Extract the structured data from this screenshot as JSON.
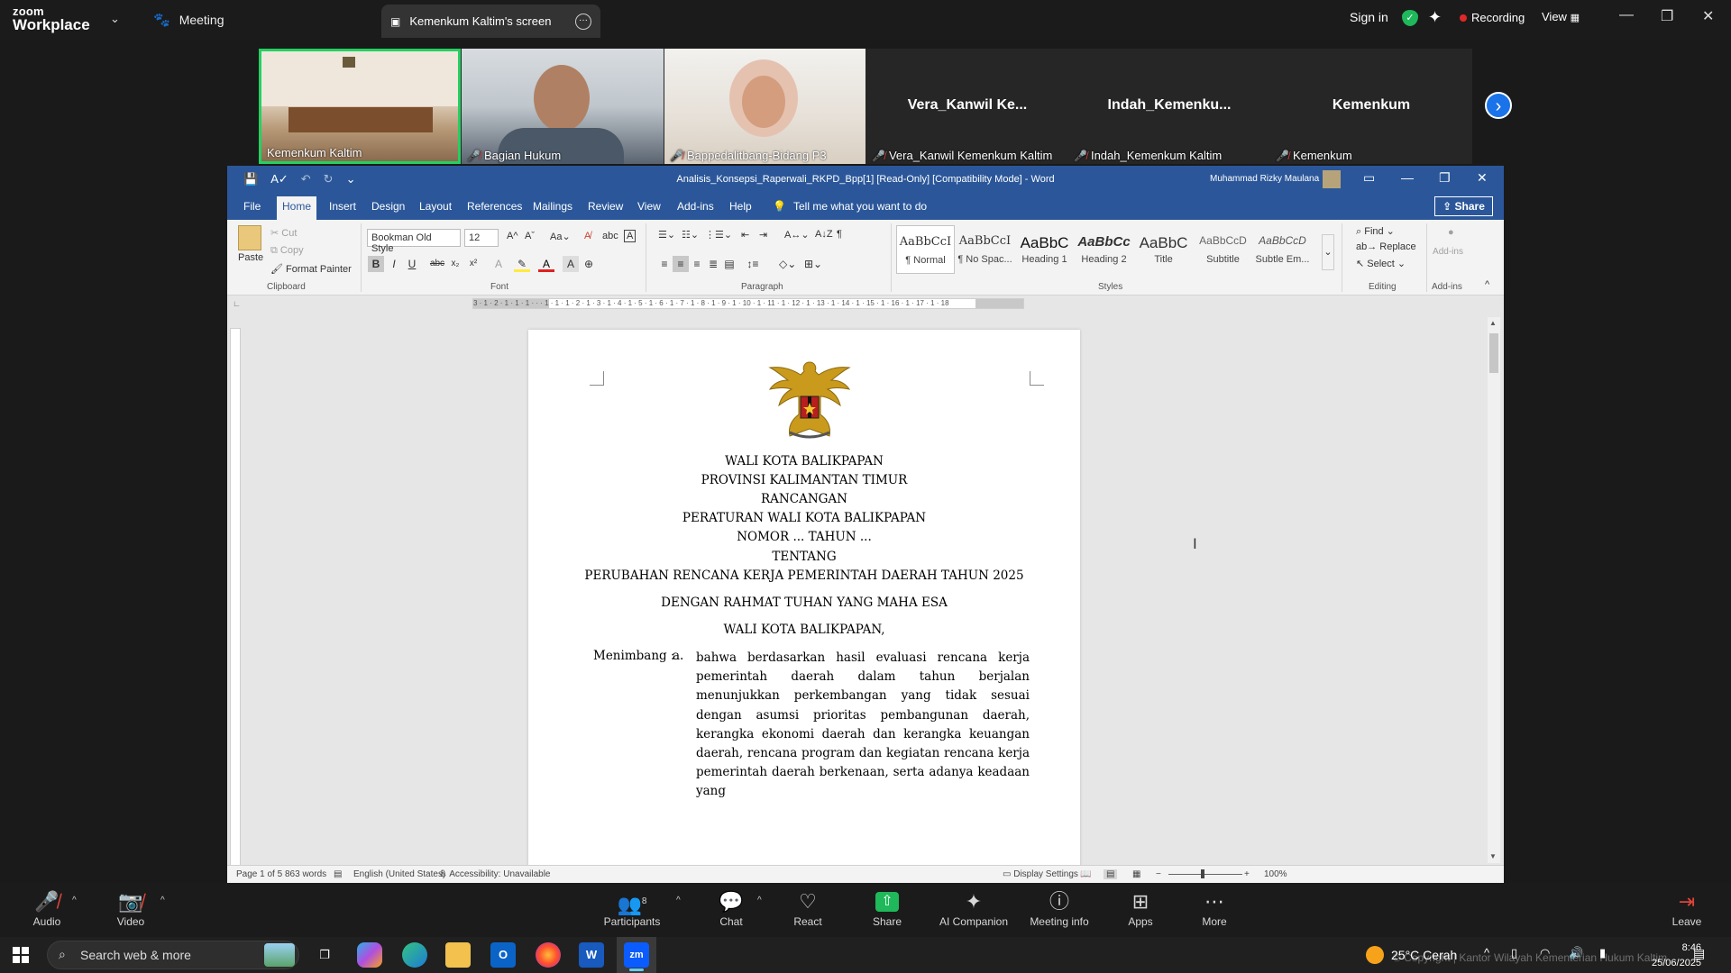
{
  "zoom_top": {
    "logo_line1": "zoom",
    "logo_line2": "Workplace",
    "meeting_label": "Meeting",
    "screen_tab_label": "Kemenkum Kaltim's screen",
    "signin_label": "Sign in",
    "recording_label": "Recording",
    "view_label": "View"
  },
  "participants": [
    {
      "name": "Kemenkum Kaltim",
      "muted": false
    },
    {
      "name": "Bagian Hukum",
      "muted": true
    },
    {
      "name": "Bappedalitbang-Bidang P3",
      "muted": true
    },
    {
      "name": "Vera_Kanwil Kemenkum Kaltim",
      "display": "Vera_Kanwil  Ke...",
      "muted": true
    },
    {
      "name": "Indah_Kemenkum Kaltim",
      "display": "Indah_Kemenku...",
      "muted": true
    },
    {
      "name": "Kemenkum",
      "display": "Kemenkum",
      "muted": true
    }
  ],
  "word": {
    "doc_title": "Analisis_Konsepsi_Raperwali_RKPD_Bpp[1] [Read-Only] [Compatibility Mode]  -  Word",
    "user_name": "Muhammad Rizky Maulana",
    "tabs": [
      "File",
      "Home",
      "Insert",
      "Design",
      "Layout",
      "References",
      "Mailings",
      "Review",
      "View",
      "Add-ins",
      "Help"
    ],
    "tell_me": "Tell me what you want to do",
    "share_label": "Share",
    "clipboard": {
      "paste": "Paste",
      "cut": "Cut",
      "copy": "Copy",
      "format_painter": "Format Painter",
      "group": "Clipboard"
    },
    "font": {
      "name": "Bookman Old Style",
      "size": "12",
      "group": "Font"
    },
    "paragraph_group": "Paragraph",
    "styles": [
      {
        "preview": "AaBbCcI",
        "label": "¶ Normal"
      },
      {
        "preview": "AaBbCcI",
        "label": "¶ No Spac..."
      },
      {
        "preview": "AaBbC",
        "label": "Heading 1"
      },
      {
        "preview": "AaBbCc",
        "label": "Heading 2"
      },
      {
        "preview": "AaBbC",
        "label": "Title"
      },
      {
        "preview": "AaBbCcD",
        "label": "Subtitle"
      },
      {
        "preview": "AaBbCcD",
        "label": "Subtle Em..."
      }
    ],
    "styles_group": "Styles",
    "editing": {
      "find": "Find",
      "replace": "Replace",
      "select": "Select",
      "group": "Editing"
    },
    "addins": {
      "label": "Add-ins",
      "group": "Add-ins"
    },
    "ruler_text": "3 · 1 · 2 · 1 · 1 · 1 · · · 1 · 1 · 1 · 2 · 1 · 3 · 1 · 4 · 1 · 5 · 1 · 6 · 1 · 7 · 1 · 8 · 1 · 9 · 1 · 10 · 1 · 11 · 1 · 12 · 1 · 13 · 1 · 14 · 1 · 15 · 1 · 16 · 1 · 17 · 1 · 18",
    "document": {
      "heading_lines": [
        "WALI KOTA BALIKPAPAN",
        "PROVINSI KALIMANTAN TIMUR",
        "RANCANGAN",
        "PERATURAN WALI KOTA BALIKPAPAN",
        "NOMOR ... TAHUN ...",
        "TENTANG",
        "PERUBAHAN RENCANA KERJA PEMERINTAH DAERAH TAHUN 2025"
      ],
      "rahmat": "DENGAN RAHMAT TUHAN YANG MAHA ESA",
      "wali": "WALI KOTA BALIKPAPAN,",
      "menimbang_label": "Menimbang :",
      "item_letter": "a.",
      "body": "bahwa berdasarkan hasil evaluasi rencana kerja pemerintah daerah dalam tahun berjalan menunjukkan perkembangan yang tidak sesuai dengan asumsi prioritas pembangunan daerah, kerangka ekonomi daerah dan kerangka keuangan daerah, rencana program dan kegiatan rencana kerja pemerintah daerah berkenaan, serta adanya keadaan yang"
    },
    "status": {
      "page": "Page 1 of 5",
      "words": "863 words",
      "language": "English (United States)",
      "accessibility": "Accessibility: Unavailable",
      "display_settings": "Display Settings",
      "zoom": "100%"
    }
  },
  "zoom_bottom": {
    "audio": "Audio",
    "video": "Video",
    "participants": "Participants",
    "participants_count": "8",
    "chat": "Chat",
    "react": "React",
    "share": "Share",
    "ai": "AI Companion",
    "info": "Meeting info",
    "apps": "Apps",
    "more": "More",
    "leave": "Leave"
  },
  "taskbar": {
    "search": "Search web & more",
    "weather": "25°C  Cerah",
    "time": "8:46",
    "date": "25/06/2025",
    "watermark": "© Copyright | Kantor Wilayah Kementerian Hukum Kaltim"
  },
  "colors": {
    "word_blue": "#2b579a",
    "zoom_green": "#23d160",
    "zoom_blue": "#1a73e8"
  }
}
